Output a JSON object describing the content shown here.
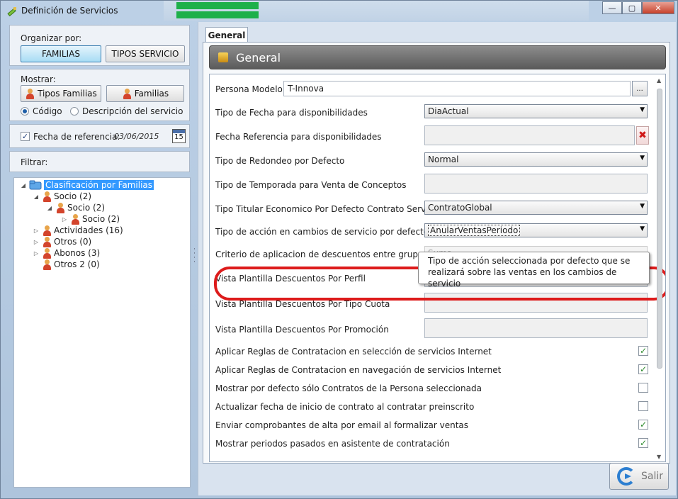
{
  "window": {
    "title": "Definición de Servicios",
    "controls": {
      "minimize": "—",
      "maximize": "▢",
      "close": "✕"
    }
  },
  "left": {
    "organizar": {
      "label": "Organizar por:",
      "buttons": [
        {
          "label": "FAMILIAS",
          "active": true
        },
        {
          "label": "TIPOS SERVICIO",
          "active": false
        }
      ]
    },
    "mostrar": {
      "label": "Mostrar:",
      "buttons": [
        "Tipos Familias",
        "Familias"
      ],
      "radios": [
        {
          "label": "Código",
          "checked": true
        },
        {
          "label": "Descripción del servicio",
          "checked": false
        }
      ]
    },
    "fecha": {
      "label": "Fecha de referencia:",
      "checked": true,
      "value": "03/06/2015",
      "calendar_day": "15"
    },
    "filtrar": {
      "label": "Filtrar:"
    },
    "tree": [
      {
        "label": "Clasificación por Familias",
        "level": 0,
        "expand": "◢",
        "selected": true
      },
      {
        "label": "Socio (2)",
        "level": 1,
        "expand": "◢"
      },
      {
        "label": "Socio (2)",
        "level": 2,
        "expand": "◢"
      },
      {
        "label": "Socio (2)",
        "level": 3,
        "expand": "▷"
      },
      {
        "label": "Actividades (16)",
        "level": 1,
        "expand": "▷"
      },
      {
        "label": "Otros (0)",
        "level": 1,
        "expand": "▷"
      },
      {
        "label": "Abonos (3)",
        "level": 1,
        "expand": "▷"
      },
      {
        "label": "Otros 2 (0)",
        "level": 1,
        "expand": ""
      }
    ]
  },
  "right": {
    "tab": "General",
    "header": "General",
    "props": {
      "persona_modelo": {
        "label": "Persona Modelo",
        "value": "T-Innova",
        "button": "..."
      },
      "tipo_fecha": {
        "label": "Tipo de Fecha para disponibilidades",
        "value": "DiaActual"
      },
      "fecha_referencia": {
        "label": "Fecha Referencia para disponibilidades",
        "value": "",
        "clear": "✖"
      },
      "tipo_redondeo": {
        "label": "Tipo de Redondeo por Defecto",
        "value": "Normal"
      },
      "tipo_temporada": {
        "label": "Tipo de Temporada para Venta de Conceptos",
        "value": ""
      },
      "tipo_titular": {
        "label": "Tipo Titular Economico Por Defecto Contrato Servicio",
        "value": "ContratoGlobal"
      },
      "tipo_accion": {
        "label": "Tipo de acción en cambios de servicio por defecto",
        "value": "AnularVentasPeriodo"
      },
      "criterio": {
        "label": "Criterio de aplicacion de descuentos entre grupos",
        "value": "Suma"
      },
      "vista_perfil": {
        "label": "Vista Plantilla Descuentos Por Perfil",
        "value": ""
      },
      "vista_cuota": {
        "label": "Vista Plantilla Descuentos Por Tipo Cuota",
        "value": ""
      },
      "vista_promocion": {
        "label": "Vista Plantilla Descuentos Por Promoción",
        "value": ""
      }
    },
    "checks": [
      {
        "label": "Aplicar Reglas de Contratacion en selección de servicios Internet",
        "checked": true
      },
      {
        "label": "Aplicar Reglas de Contratacion en navegación de servicios Internet",
        "checked": true
      },
      {
        "label": "Mostrar por defecto sólo Contratos de la Persona seleccionada",
        "checked": false
      },
      {
        "label": "Actualizar fecha de inicio de contrato al contratar preinscrito",
        "checked": false
      },
      {
        "label": "Enviar comprobantes de alta por email al formalizar ventas",
        "checked": true
      },
      {
        "label": "Mostrar periodos pasados en asistente de contratación",
        "checked": true
      }
    ],
    "tooltip": "Tipo de acción seleccionada por defecto que se realizará sobre las ventas en los cambios de servicio",
    "exit_button": "Salir"
  },
  "colors": {
    "accent": "#3399ff",
    "highlight": "#dd1b1b",
    "check": "#2b8a2b"
  }
}
